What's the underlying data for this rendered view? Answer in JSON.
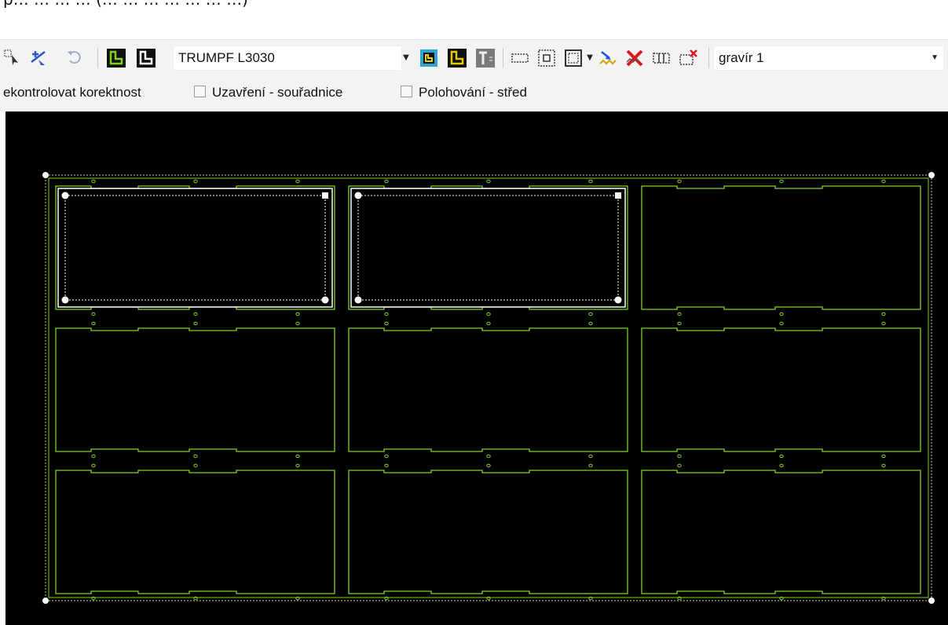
{
  "header": {
    "cut_text": "p… … … … (… … … … … … …)"
  },
  "toolbar": {
    "machine_combo": {
      "value": "TRUMPF L3030"
    },
    "layer_combo": {
      "value": "gravír 1"
    }
  },
  "options": {
    "check_correctness_label": "ekontrolovat korektnost",
    "close_coords": {
      "label": "Uzavření - souřadnice",
      "checked": false
    },
    "position_center": {
      "label": "Polohování - střed",
      "checked": false
    }
  },
  "colors": {
    "canvas_bg": "#000000",
    "part_outline": "#7fd320",
    "selection": "#ffffff",
    "toolbar_bg": "#f3f3f3"
  },
  "nesting": {
    "rows": 3,
    "cols": 3,
    "selected_parts": [
      [
        0,
        0
      ],
      [
        0,
        1
      ]
    ]
  }
}
